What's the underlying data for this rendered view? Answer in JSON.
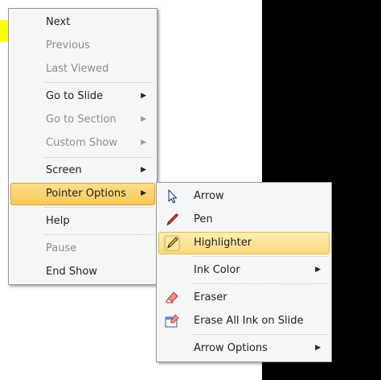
{
  "main_menu": {
    "items": [
      {
        "label": "Next",
        "enabled": true
      },
      {
        "label": "Previous",
        "enabled": false
      },
      {
        "label": "Last Viewed",
        "enabled": false
      },
      {
        "label": "Go to Slide",
        "enabled": true,
        "submenu": true
      },
      {
        "label": "Go to Section",
        "enabled": false,
        "submenu": true
      },
      {
        "label": "Custom Show",
        "enabled": false,
        "submenu": true
      },
      {
        "label": "Screen",
        "enabled": true,
        "submenu": true
      },
      {
        "label": "Pointer Options",
        "enabled": true,
        "submenu": true,
        "state": "pressed"
      },
      {
        "label": "Help",
        "enabled": true
      },
      {
        "label": "Pause",
        "enabled": false
      },
      {
        "label": "End Show",
        "enabled": true
      }
    ]
  },
  "pointer_submenu": {
    "items": [
      {
        "label": "Arrow",
        "icon": "arrow-pointer-icon"
      },
      {
        "label": "Pen",
        "icon": "pen-icon"
      },
      {
        "label": "Highlighter",
        "icon": "highlighter-icon",
        "state": "hover"
      },
      {
        "label": "Ink Color",
        "submenu": true
      },
      {
        "label": "Eraser",
        "icon": "eraser-icon"
      },
      {
        "label": "Erase All Ink on Slide",
        "icon": "erase-all-ink-icon"
      },
      {
        "label": "Arrow Options",
        "submenu": true
      }
    ]
  },
  "colors": {
    "hover_highlight": "#fbdb7c",
    "menu_background": "#f5f6f7",
    "disabled_text": "#8d8d8d",
    "slide_yellow": "#ffff00",
    "slide_black": "#000000"
  }
}
